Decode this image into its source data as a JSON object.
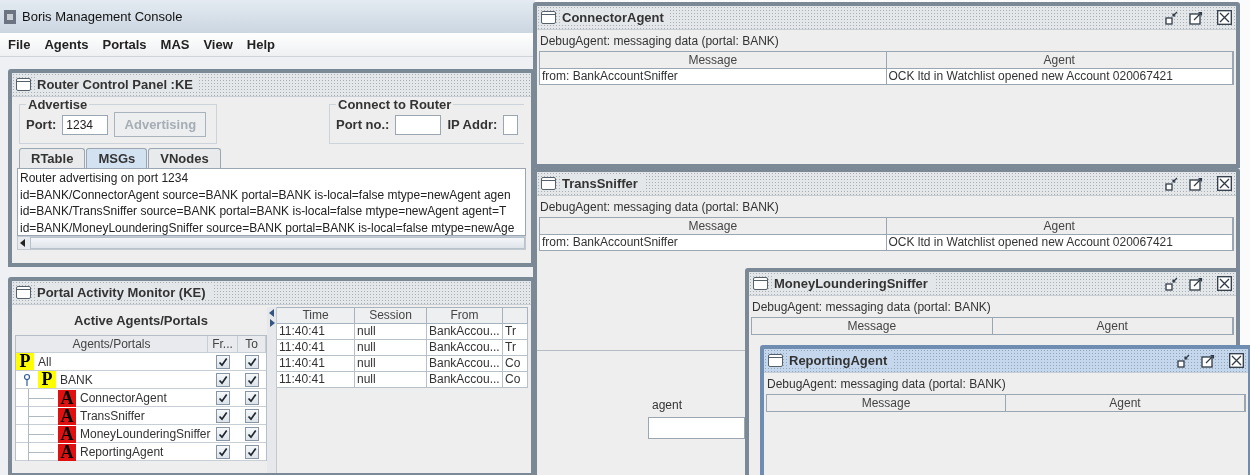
{
  "app": {
    "title": "Boris Management Console"
  },
  "menu": [
    {
      "label": "File"
    },
    {
      "label": "Agents"
    },
    {
      "label": "Portals"
    },
    {
      "label": "MAS"
    },
    {
      "label": "View"
    },
    {
      "label": "Help"
    }
  ],
  "router_panel": {
    "title": "Router Control Panel :KE",
    "selected": false,
    "advertise": {
      "title": "Advertise",
      "port_label": "Port:",
      "port_value": "1234",
      "button": {
        "label": "Advertising",
        "disabled": true
      }
    },
    "connect": {
      "title": "Connect to Router",
      "port_label": "Port no.:",
      "ip_label": "IP Addr:"
    },
    "tabs": [
      {
        "label": "RTable",
        "selected": false
      },
      {
        "label": "MSGs",
        "selected": true
      },
      {
        "label": "VNodes",
        "selected": false
      }
    ],
    "log_lines": [
      "Router advertising on port 1234",
      "id=BANK/ConnectorAgent source=BANK portal=BANK is-local=false mtype=newAgent agen",
      "id=BANK/TransSniffer source=BANK portal=BANK is-local=false mtype=newAgent agent=T",
      "id=BANK/MoneyLounderingSniffer source=BANK portal=BANK is-local=false mtype=newAge"
    ]
  },
  "activity_monitor": {
    "title": "Portal Activity Monitor  (KE)",
    "selected": false,
    "tree_title": "Active Agents/Portals",
    "tree_columns": [
      "Agents/Portals",
      "Fr...",
      "To"
    ],
    "tree": [
      {
        "label": "All",
        "kind": "portal",
        "badge": "P",
        "from": true,
        "to": true
      },
      {
        "label": "BANK",
        "kind": "portal",
        "badge": "P",
        "from": true,
        "to": true,
        "expanded": true,
        "children": [
          {
            "label": "ConnectorAgent",
            "kind": "agent",
            "badge": "A",
            "from": true,
            "to": true
          },
          {
            "label": "TransSniffer",
            "kind": "agent",
            "badge": "A",
            "from": true,
            "to": true
          },
          {
            "label": "MoneyLounderingSniffer",
            "kind": "agent",
            "badge": "A",
            "from": true,
            "to": true
          },
          {
            "label": "ReportingAgent",
            "kind": "agent",
            "badge": "A",
            "from": true,
            "to": true
          }
        ]
      }
    ],
    "table": {
      "columns": [
        "Time",
        "Session",
        "From"
      ],
      "rows": [
        [
          "11:40:41",
          "null",
          "BankAccou...",
          "Tr"
        ],
        [
          "11:40:41",
          "null",
          "BankAccou...",
          "Tr"
        ],
        [
          "11:40:41",
          "null",
          "BankAccou...",
          "Co"
        ],
        [
          "11:40:41",
          "null",
          "BankAccou...",
          "Co"
        ]
      ]
    }
  },
  "debug_windows": [
    {
      "title": "ConnectorAgent",
      "selected": false,
      "caption": "DebugAgent: messaging data (portal: BANK)",
      "columns": [
        "Message",
        "Agent"
      ],
      "rows": [
        [
          "from: BankAccountSniffer",
          "OCK ltd in Watchlist opened new Account 020067421"
        ]
      ]
    },
    {
      "title": "TransSniffer",
      "selected": false,
      "caption": "DebugAgent: messaging data (portal: BANK)",
      "columns": [
        "Message",
        "Agent"
      ],
      "rows": [
        [
          "from: BankAccountSniffer",
          "OCK ltd in Watchlist opened new Account 020067421"
        ]
      ],
      "footer": {
        "label": "agent"
      }
    },
    {
      "title": "MoneyLounderingSniffer",
      "selected": false,
      "caption": "DebugAgent: messaging data (portal: BANK)",
      "columns": [
        "Message",
        "Agent"
      ]
    },
    {
      "title": "ReportingAgent",
      "selected": true,
      "caption": "DebugAgent: messaging data (portal: BANK)",
      "columns": [
        "Message",
        "Agent"
      ]
    }
  ]
}
